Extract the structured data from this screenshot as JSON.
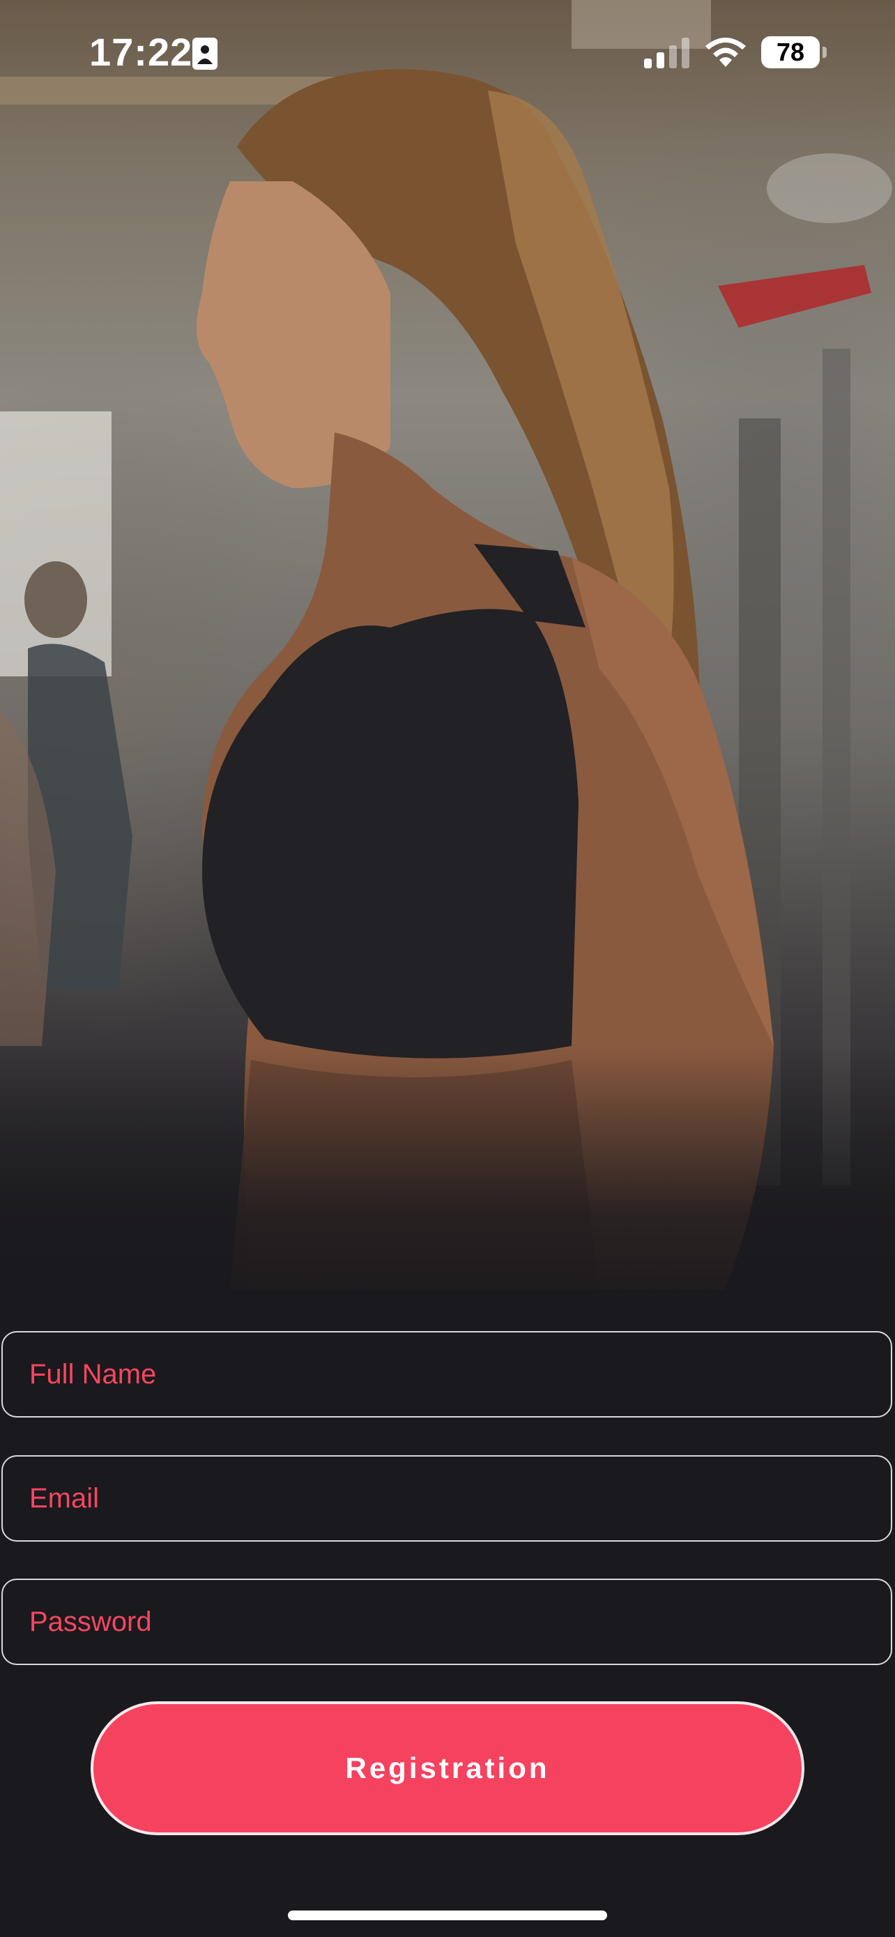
{
  "status_bar": {
    "time": "17:22",
    "battery_level": "78",
    "icons": [
      "contact-card-icon",
      "signal-icon",
      "wifi-icon",
      "battery-icon"
    ]
  },
  "hero": {
    "image": "woman-in-gym-photo"
  },
  "form": {
    "full_name": {
      "placeholder": "Full Name",
      "value": ""
    },
    "email": {
      "placeholder": "Email",
      "value": ""
    },
    "password": {
      "placeholder": "Password",
      "value": ""
    },
    "submit_label": "Registration"
  },
  "colors": {
    "background": "#1a191d",
    "accent": "#f5425f",
    "placeholder": "#f6475f",
    "field_border": "#d9d9dc"
  }
}
